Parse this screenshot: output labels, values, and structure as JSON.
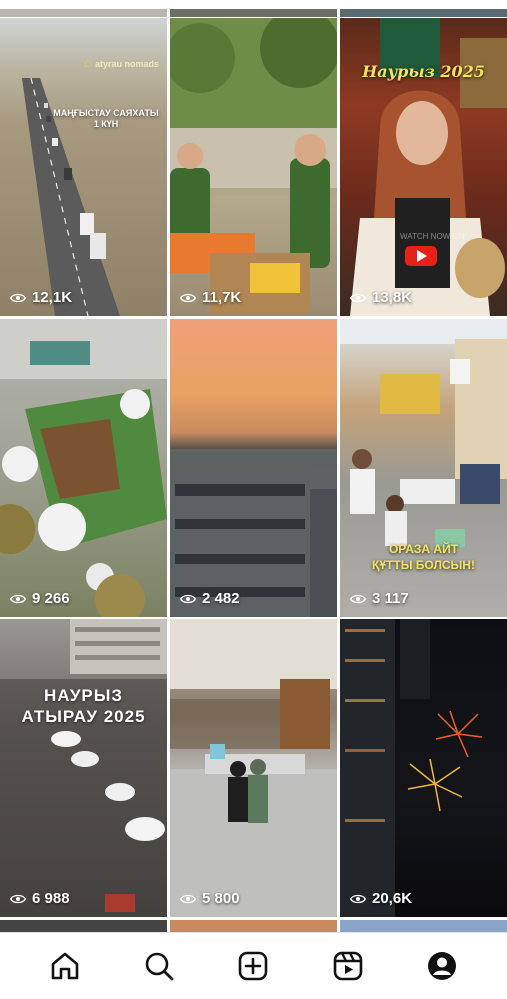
{
  "tiles": [
    {
      "id": "t1",
      "views": "12,1K",
      "overlay": "МАҢҒЫСТАУ САЯХАТЫ\n1 КҮН",
      "logo": "atyrau nomads"
    },
    {
      "id": "t2",
      "views": "11,7K"
    },
    {
      "id": "t3",
      "views": "13,8K",
      "overlay": "Наурыз 2025",
      "watermark": "WATCH NOW ON"
    },
    {
      "id": "t4",
      "views": "9 266"
    },
    {
      "id": "t5",
      "views": "2 482"
    },
    {
      "id": "t6",
      "views": "3 117",
      "overlay": "ОРАЗА АЙТ\nҚҰТТЫ БОЛСЫН!"
    },
    {
      "id": "t7",
      "views": "6 988",
      "overlay": "НАУРЫЗ\nАТЫРАУ 2025"
    },
    {
      "id": "t8",
      "views": "5 800"
    },
    {
      "id": "t9",
      "views": "20,6K"
    }
  ],
  "nav": {
    "items": [
      "home-icon",
      "search-icon",
      "create-icon",
      "reels-icon",
      "profile-icon"
    ]
  },
  "colors": {
    "nav_bg": "#ffffff",
    "icon": "#111111",
    "overlay_yellow": "#f7e35b"
  }
}
